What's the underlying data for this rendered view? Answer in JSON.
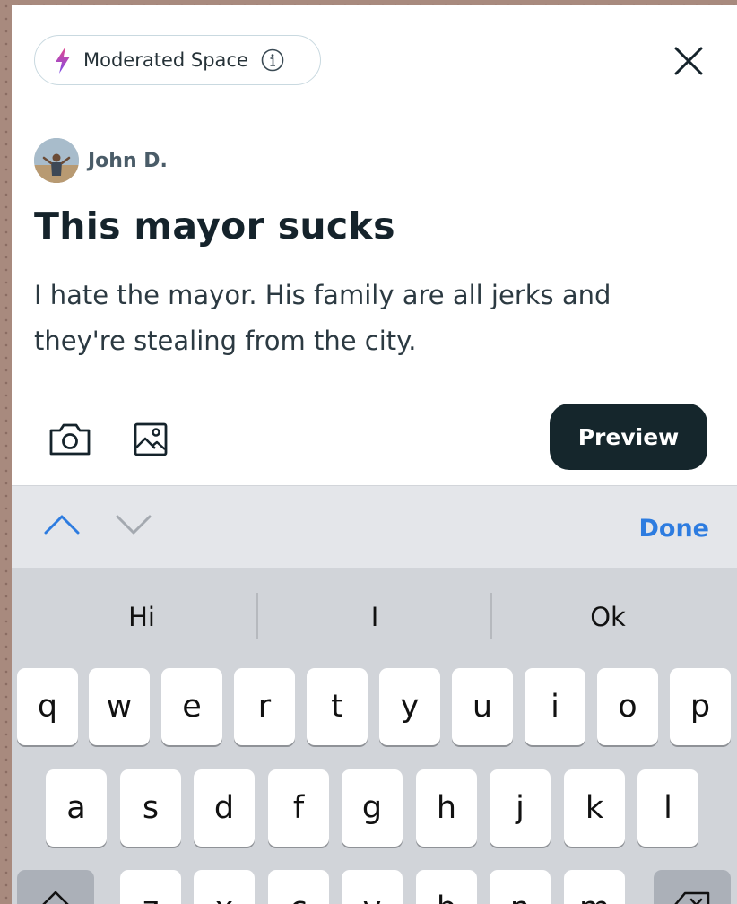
{
  "post": {
    "badge_label": "Moderated Space",
    "author": "John D.",
    "title": "This mayor sucks",
    "body": "I hate the mayor. His family are all jerks and they're stealing from the city.",
    "preview_label": "Preview"
  },
  "accessory": {
    "done_label": "Done"
  },
  "keyboard": {
    "suggestions": [
      "Hi",
      "I",
      "Ok"
    ],
    "row1": [
      "q",
      "w",
      "e",
      "r",
      "t",
      "y",
      "u",
      "i",
      "o",
      "p"
    ],
    "row2": [
      "a",
      "s",
      "d",
      "f",
      "g",
      "h",
      "j",
      "k",
      "l"
    ],
    "row3": [
      "z",
      "x",
      "c",
      "v",
      "b",
      "n",
      "m"
    ]
  },
  "icons": {
    "badge": "lightning-bolt-icon",
    "info": "info-icon",
    "close": "close-icon",
    "camera": "camera-icon",
    "image": "image-icon",
    "prev": "chevron-up-icon",
    "next": "chevron-down-icon",
    "shift": "shift-icon",
    "backspace": "backspace-icon"
  },
  "colors": {
    "accent": "#2d7ce0",
    "button": "#15262c",
    "bolt_top": "#e6478b",
    "bolt_bottom": "#7d4ce8"
  }
}
